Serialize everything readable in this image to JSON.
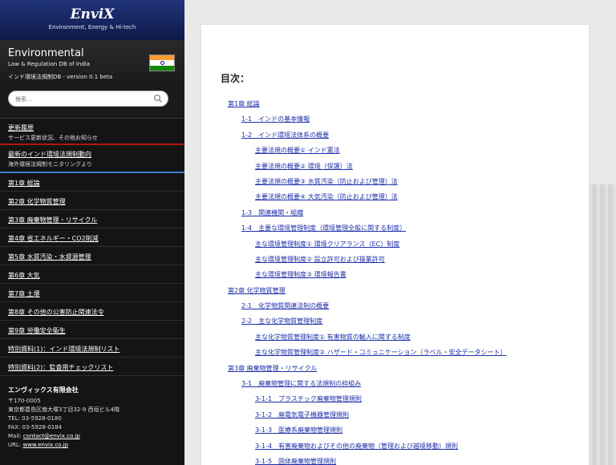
{
  "brand": {
    "name": "EnviX",
    "tagline": "Environment, Energy & Hi-tech"
  },
  "app": {
    "title": "Environmental",
    "subtitle": "Law & Regulation DB of India",
    "version": "インド環境法規制DB - version 0.1 beta"
  },
  "search": {
    "placeholder": "検索..."
  },
  "news": [
    {
      "title": "更新履歴",
      "sub": "サービス更新状況、その他お知らせ"
    },
    {
      "title": "最新のインド環境法規制動向",
      "sub": "海外環境法規制モニタリングより"
    }
  ],
  "nav": [
    "第1章 総論",
    "第2章 化学物質管理",
    "第3章 廃棄物管理・リサイクル",
    "第4章 省エネルギー・CO2削減",
    "第5章 水質汚染・水資源管理",
    "第6章 大気",
    "第7章 土壌",
    "第8章 その他の公害防止関連法令",
    "第9章 労働安全衛生",
    "特別資料(1)：インド環境法規制リスト",
    "特別資料(2)：監査用チェックリスト"
  ],
  "company": {
    "name": "エンヴィックス有限会社",
    "postal": "〒170-0005",
    "address": "東京都豊島区南大塚3丁目32-9 西垣ビル4階",
    "tel": "TEL: 03-5928-0180",
    "fax": "FAX: 03-5928-0184",
    "mail_label": "Mail: ",
    "mail": "contact@envix.co.jp",
    "url_label": "URL: ",
    "url": "www.envix.co.jp"
  },
  "toc": {
    "heading": "目次：",
    "items": [
      {
        "level": 0,
        "text": "第1章 総論"
      },
      {
        "level": 1,
        "text": "1-1　インドの基本情報"
      },
      {
        "level": 1,
        "text": "1-2　インド環境法体系の概要"
      },
      {
        "level": 2,
        "text": "主要法規の概要① インド憲法"
      },
      {
        "level": 2,
        "text": "主要法規の概要② 環境（保護）法"
      },
      {
        "level": 2,
        "text": "主要法規の概要③ 水質汚染（防止および管理）法"
      },
      {
        "level": 2,
        "text": "主要法規の概要④ 大気汚染（防止および管理）法"
      },
      {
        "level": 1,
        "text": "1-3　関連機関・組織"
      },
      {
        "level": 1,
        "text": "1-4　主要な環境管理制度（環境管理全般に関する制度）"
      },
      {
        "level": 2,
        "text": "主な環境管理制度① 環境クリアランス（EC）制度"
      },
      {
        "level": 2,
        "text": "主な環境管理制度② 設立許可および操業許可"
      },
      {
        "level": 2,
        "text": "主な環境管理制度③ 環境報告書"
      },
      {
        "level": 0,
        "text": "第2章 化学物質管理"
      },
      {
        "level": 1,
        "text": "2-1　化学物質関連法制の概要"
      },
      {
        "level": 1,
        "text": "2-2　主な化学物質管理制度"
      },
      {
        "level": 2,
        "text": "主な化学物質管理制度① 有害物質の輸入に関する制度"
      },
      {
        "level": 2,
        "text": "主な化学物質管理制度② ハザード・コミュニケーション（ラベル・安全データシート）"
      },
      {
        "level": 0,
        "text": "第3章 廃棄物管理・リサイクル"
      },
      {
        "level": 1,
        "text": "3-1　廃棄物管理に関する法規制の枠組み"
      },
      {
        "level": 2,
        "text": "3-1-1　プラスチック廃棄物管理規則"
      },
      {
        "level": 2,
        "text": "3-1-2　廃電気電子機器管理規則"
      },
      {
        "level": 2,
        "text": "3-1-3　医療系廃棄物管理規則"
      },
      {
        "level": 2,
        "text": "3-1-4　有害廃棄物およびその他の廃棄物（管理および越境移動）規則"
      },
      {
        "level": 2,
        "text": "3-1-5　固体廃棄物管理規則"
      }
    ]
  }
}
